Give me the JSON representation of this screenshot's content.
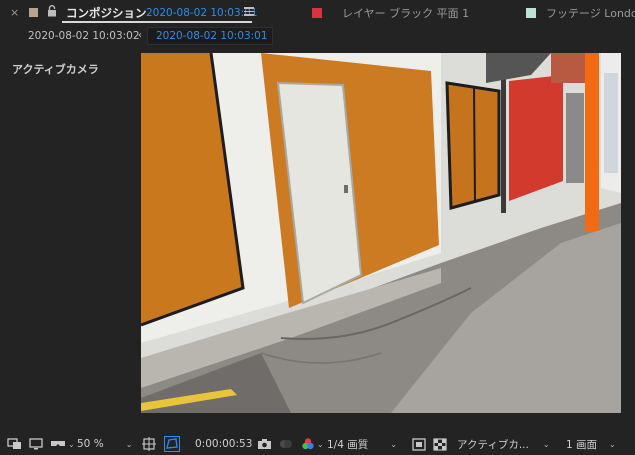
{
  "tabs": {
    "close_glyph": "×",
    "active": {
      "swatch_color": "#b8a48c",
      "title": "コンポジション",
      "name": "2020-08-02 10:03:01"
    },
    "others": [
      {
        "swatch_color": "#d8333f",
        "label": "レイヤー ブラック 平面 1"
      },
      {
        "swatch_color": "#b9e3d5",
        "label": "フッテージ London On"
      }
    ]
  },
  "breadcrumb": {
    "items": [
      "2020-08-02 10:03:02",
      "2020-08-02 10:03:01"
    ],
    "arrow": "‹"
  },
  "viewer": {
    "camera_label": "アクティブカメラ"
  },
  "bottom_toolbar": {
    "zoom": "50 %",
    "timecode": "0:00:00:53",
    "resolution": "1/4 画質",
    "camera_view": "アクティブカ...",
    "view_layout": "1 画面",
    "chevron": "⌄"
  },
  "colors": {
    "accent_blue": "#2d8ceb",
    "panel_bg": "#232323"
  }
}
